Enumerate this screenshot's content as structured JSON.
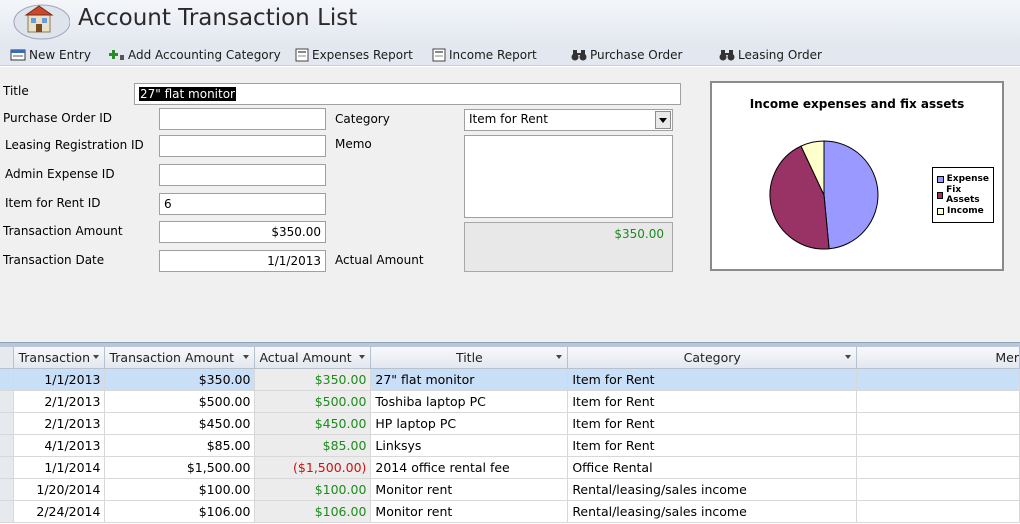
{
  "window": {
    "title": "Account Transaction List"
  },
  "toolbar": {
    "new_entry": "New Entry",
    "add_category": "Add Accounting Category",
    "expenses_report": "Expenses Report",
    "income_report": "Income Report",
    "purchase_order": "Purchase Order",
    "leasing_order": "Leasing Order"
  },
  "form": {
    "title_label": "Title",
    "title_value": "27\" flat monitor",
    "po_label": "Purchase Order ID",
    "po_value": "",
    "leasing_label": "Leasing Registration ID",
    "leasing_value": "",
    "admin_label": "Admin Expense ID",
    "admin_value": "",
    "rent_label": "Item for Rent ID",
    "rent_value": "6",
    "amount_label": "Transaction Amount",
    "amount_value": "$350.00",
    "date_label": "Transaction Date",
    "date_value": "1/1/2013",
    "category_label": "Category",
    "category_value": "Item for Rent",
    "memo_label": "Memo",
    "memo_value": "",
    "actual_label": "Actual Amount",
    "actual_value": "$350.00"
  },
  "chart": {
    "title": "Income expenses and fix assets",
    "legend": [
      "Expense",
      "Fix Assets",
      "Income"
    ]
  },
  "chart_data": {
    "type": "pie",
    "title": "Income expenses and fix assets",
    "categories": [
      "Expense",
      "Fix Assets",
      "Income"
    ],
    "values": [
      48.5,
      44.5,
      7.0
    ],
    "colors": [
      "#9999ff",
      "#993366",
      "#ffffcc"
    ],
    "legend_position": "right"
  },
  "grid": {
    "columns": [
      "Transaction",
      "Transaction Amount",
      "Actual Amount",
      "Title",
      "Category",
      "Mer"
    ],
    "rows": [
      {
        "date": "1/1/2013",
        "amount": "$350.00",
        "actual": "$350.00",
        "title": "27\" flat monitor",
        "category": "Item for Rent",
        "memo": ""
      },
      {
        "date": "2/1/2013",
        "amount": "$500.00",
        "actual": "$500.00",
        "title": "Toshiba laptop PC",
        "category": "Item for Rent",
        "memo": ""
      },
      {
        "date": "2/1/2013",
        "amount": "$450.00",
        "actual": "$450.00",
        "title": "HP laptop PC",
        "category": "Item for Rent",
        "memo": ""
      },
      {
        "date": "4/1/2013",
        "amount": "$85.00",
        "actual": "$85.00",
        "title": "Linksys",
        "category": "Item for Rent",
        "memo": ""
      },
      {
        "date": "1/1/2014",
        "amount": "$1,500.00",
        "actual": "($1,500.00)",
        "title": "2014 office rental fee",
        "category": "Office Rental",
        "memo": ""
      },
      {
        "date": "1/20/2014",
        "amount": "$100.00",
        "actual": "$100.00",
        "title": "Monitor rent",
        "category": "Rental/leasing/sales income",
        "memo": ""
      },
      {
        "date": "2/24/2014",
        "amount": "$106.00",
        "actual": "$106.00",
        "title": "Monitor rent",
        "category": "Rental/leasing/sales income",
        "memo": ""
      }
    ]
  }
}
